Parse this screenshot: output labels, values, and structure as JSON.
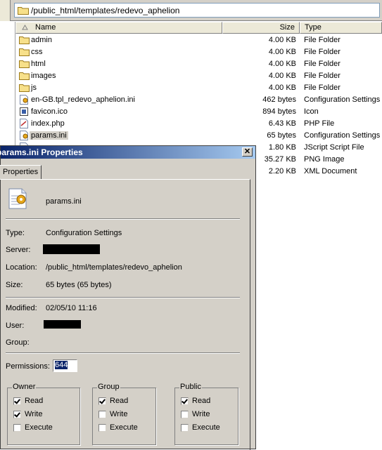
{
  "path_bar": {
    "path": "/public_html/templates/redevo_aphelion"
  },
  "columns": {
    "name": "Name",
    "size": "Size",
    "type": "Type"
  },
  "files": [
    {
      "icon": "folder-icon",
      "name": "admin",
      "size": "4.00 KB",
      "type": "File Folder"
    },
    {
      "icon": "folder-icon",
      "name": "css",
      "size": "4.00 KB",
      "type": "File Folder"
    },
    {
      "icon": "folder-icon",
      "name": "html",
      "size": "4.00 KB",
      "type": "File Folder"
    },
    {
      "icon": "folder-icon",
      "name": "images",
      "size": "4.00 KB",
      "type": "File Folder"
    },
    {
      "icon": "folder-icon",
      "name": "js",
      "size": "4.00 KB",
      "type": "File Folder"
    },
    {
      "icon": "settings-file-icon",
      "name": "en-GB.tpl_redevo_aphelion.ini",
      "size": "462 bytes",
      "type": "Configuration Settings"
    },
    {
      "icon": "ico-file-icon",
      "name": "favicon.ico",
      "size": "894 bytes",
      "type": "Icon"
    },
    {
      "icon": "php-file-icon",
      "name": "index.php",
      "size": "6.43 KB",
      "type": "PHP File"
    },
    {
      "icon": "settings-file-icon",
      "name": "params.ini",
      "size": "65 bytes",
      "type": "Configuration Settings"
    },
    {
      "icon": "script-file-icon",
      "name": "",
      "size": "1.80 KB",
      "type": "JScript Script File"
    },
    {
      "icon": "",
      "name": "",
      "size": "35.27 KB",
      "type": "PNG Image"
    },
    {
      "icon": "",
      "name": "",
      "size": "2.20 KB",
      "type": "XML Document"
    }
  ],
  "dialog": {
    "title": "params.ini Properties",
    "tab": "Properties",
    "file_name": "params.ini",
    "type_label": "Type:",
    "type_value": "Configuration Settings",
    "server_label": "Server:",
    "location_label": "Location:",
    "location_value": "/public_html/templates/redevo_aphelion",
    "size_label": "Size:",
    "size_value": "65 bytes (65 bytes)",
    "modified_label": "Modified:",
    "modified_value": "02/05/10 11:16",
    "user_label": "User:",
    "group_label": "Group:",
    "permissions_label": "Permissions:",
    "permissions_value": "644",
    "groups": [
      {
        "title": "Owner",
        "read": "Read",
        "write": "Write",
        "execute": "Execute",
        "read_checked": true,
        "write_checked": true,
        "execute_checked": false
      },
      {
        "title": "Group",
        "read": "Read",
        "write": "Write",
        "execute": "Execute",
        "read_checked": true,
        "write_checked": false,
        "execute_checked": false
      },
      {
        "title": "Public",
        "read": "Read",
        "write": "Write",
        "execute": "Execute",
        "read_checked": true,
        "write_checked": false,
        "execute_checked": false
      }
    ]
  },
  "colors": {
    "titlebar_start": "#0a246a",
    "titlebar_end": "#a6caf0",
    "dialog_bg": "#d4d0c8"
  }
}
